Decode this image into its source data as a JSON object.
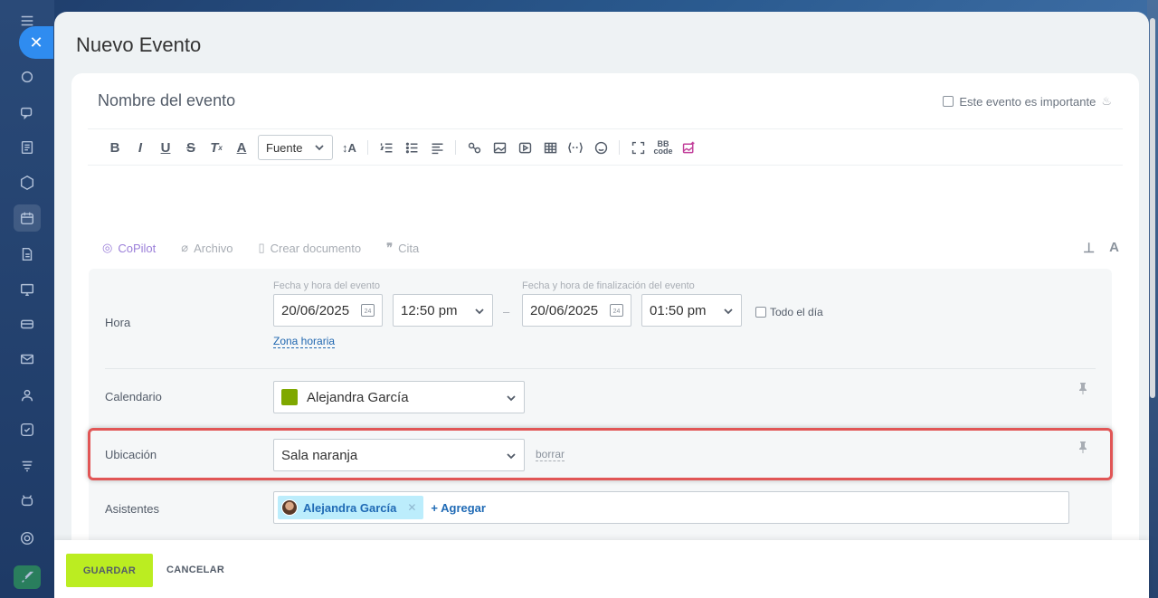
{
  "panel": {
    "title": "Nuevo Evento"
  },
  "form": {
    "event_name_placeholder": "Nombre del evento",
    "important_label": "Este evento es importante"
  },
  "toolbar": {
    "font_select": "Fuente"
  },
  "attach_bar": {
    "copilot": "CoPilot",
    "file": "Archivo",
    "create_doc": "Crear documento",
    "quote": "Cita"
  },
  "time": {
    "label": "Hora",
    "start_label": "Fecha y hora del evento",
    "start_date": "20/06/2025",
    "start_time": "12:50 pm",
    "end_label": "Fecha y hora de finalización del evento",
    "end_date": "20/06/2025",
    "end_time": "01:50 pm",
    "all_day": "Todo el día",
    "timezone_link": "Zona horaria",
    "dash": "–"
  },
  "calendar": {
    "label": "Calendario",
    "value": "Alejandra García",
    "color": "#7fa800"
  },
  "location": {
    "label": "Ubicación",
    "value": "Sala naranja",
    "clear": "borrar"
  },
  "attendees": {
    "label": "Asistentes",
    "chips": [
      "Alejandra García"
    ],
    "add": "+ Agregar"
  },
  "footer": {
    "save": "GUARDAR",
    "cancel": "CANCELAR"
  },
  "colors": {
    "save_button": "#bbed21",
    "highlight_border": "#e15656",
    "accent": "#2f8cf0"
  }
}
